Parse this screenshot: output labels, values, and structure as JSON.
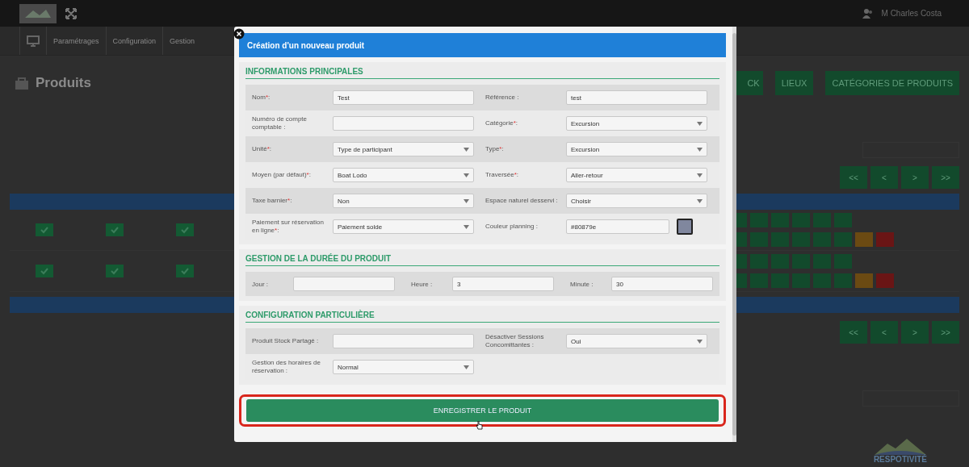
{
  "topbar": {
    "user": "M Charles Costa"
  },
  "nav": [
    {
      "label": "Paramétrages"
    },
    {
      "label": "Configuration"
    },
    {
      "label": "Gestion"
    }
  ],
  "page": {
    "title": "Produits",
    "buttons": [
      {
        "label": "CK"
      },
      {
        "label": "LIEUX"
      },
      {
        "label": "CATÉGORIES DE PRODUITS"
      }
    ],
    "pagination": [
      "<<",
      "<",
      ">",
      ">>"
    ],
    "logo": "RESPOTIVITÉ"
  },
  "modal": {
    "title": "Création d'un nouveau produit",
    "sections": [
      {
        "title": "INFORMATIONS PRINCIPALES",
        "kind": "grid",
        "rows": [
          {
            "fields": [
              {
                "label": "Nom",
                "mark": "*",
                "end": ":",
                "kind": "text",
                "value": "Test"
              },
              {
                "label": "Référence :",
                "kind": "text",
                "value": "test"
              }
            ]
          },
          {
            "fields": [
              {
                "label": "Numéro de compte comptable :",
                "kind": "text"
              },
              {
                "label": "Catégorie",
                "mark": "*",
                "end": ":",
                "kind": "select",
                "value": "Excursion"
              }
            ]
          },
          {
            "fields": [
              {
                "label": "Unité",
                "mark": "*",
                "end": ":",
                "kind": "select",
                "value": "Type de participant"
              },
              {
                "label": "Type",
                "mark": "*",
                "end": ":",
                "kind": "select",
                "value": "Excursion"
              }
            ]
          },
          {
            "fields": [
              {
                "label": "Moyen (par défaut)",
                "mark": "*",
                "end": ":",
                "kind": "select",
                "value": "Boat Lodo"
              },
              {
                "label": "Traversée",
                "mark": "*",
                "end": ":",
                "kind": "select",
                "value": "Aller-retour"
              }
            ]
          },
          {
            "fields": [
              {
                "label": "Taxe barnier",
                "mark": "*",
                "end": ":",
                "kind": "select",
                "value": "Non"
              },
              {
                "label": "Espace naturel desservi :",
                "kind": "select",
                "value": "Choisir"
              }
            ]
          },
          {
            "fields": [
              {
                "label": "Paiement sur réservation en ligne",
                "mark": "*",
                "end": ":",
                "kind": "select",
                "value": "Paiement solde"
              },
              {
                "label": "Couleur planning :",
                "kind": "color",
                "value": "#80879e"
              }
            ]
          }
        ]
      },
      {
        "title": "GESTION DE LA DURÉE DU PRODUIT",
        "kind": "inline",
        "rows": [
          {
            "fields": [
              {
                "label": "Jour :",
                "kind": "text"
              },
              {
                "label": "Heure :",
                "kind": "text",
                "value": "3"
              },
              {
                "label": "Minute :",
                "kind": "text",
                "value": "30"
              }
            ]
          }
        ]
      },
      {
        "title": "CONFIGURATION PARTICULIÈRE",
        "kind": "grid",
        "rows": [
          {
            "fields": [
              {
                "label": "Produit Stock Partagé :",
                "kind": "text"
              },
              {
                "label": "Désactiver Sessions Concomittantes :",
                "kind": "select",
                "value": "Oui"
              }
            ]
          },
          {
            "fields": [
              {
                "label": "Gestion des horaires de réservation :",
                "kind": "select",
                "value": "Normal"
              }
            ]
          }
        ]
      }
    ],
    "save_button": "ENREGISTRER LE PRODUIT"
  }
}
